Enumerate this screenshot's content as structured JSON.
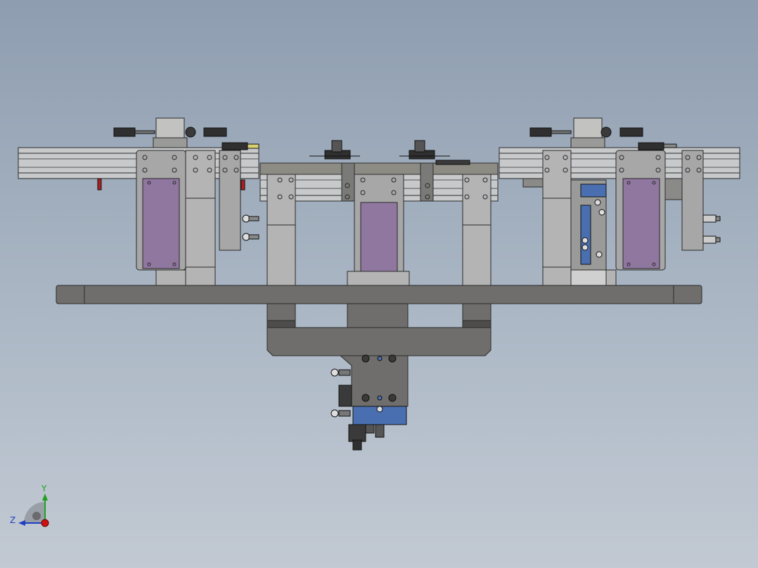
{
  "viewport": {
    "background_top": "#8e9db0",
    "background_bottom": "#c2c9d2"
  },
  "model": {
    "type": "pneumatic-conveyor-fixture-assembly",
    "view": "front",
    "colors": {
      "frame": "#6f6e6c",
      "frame_dark": "#4e4d4b",
      "plate": "#a7a7a7",
      "rail": "#c8c9cb",
      "purple_panel": "#8f77a0",
      "blue_cylinder": "#4a6fb0",
      "edge": "#2a2a2a"
    }
  },
  "triad": {
    "y_label": "Y",
    "z_label": "Z",
    "y_color": "#1fa01f",
    "z_color": "#1f3fc0",
    "x_color": "#d01010"
  }
}
